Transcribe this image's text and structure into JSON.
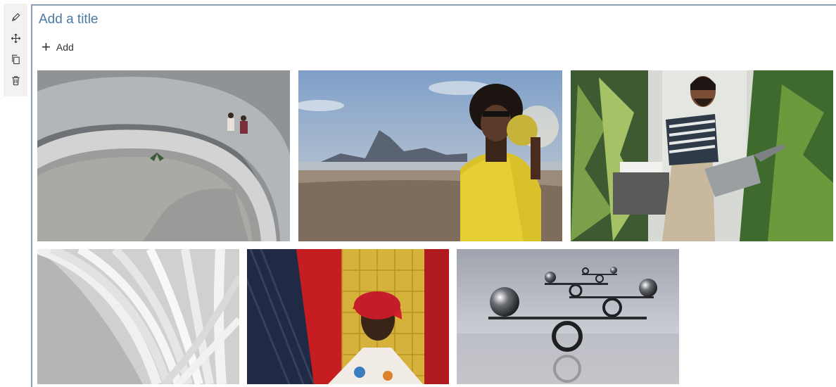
{
  "toolbar": {
    "items": [
      {
        "name": "edit",
        "icon": "pencil-icon"
      },
      {
        "name": "move",
        "icon": "move-arrows-icon"
      },
      {
        "name": "duplicate",
        "icon": "copy-icon"
      },
      {
        "name": "delete",
        "icon": "trash-icon"
      }
    ]
  },
  "webpart": {
    "title_placeholder": "Add a title",
    "add_label": "Add",
    "add_icon": "plus-icon"
  },
  "gallery": {
    "tiles": [
      {
        "id": "stairwell",
        "subject": "spiral concrete stairwell with people sitting"
      },
      {
        "id": "beach",
        "subject": "man in yellow jersey on beach holding ball"
      },
      {
        "id": "gardener",
        "subject": "man watering plants with watering can"
      },
      {
        "id": "book",
        "subject": "open book pages fanned"
      },
      {
        "id": "woman-red",
        "subject": "woman in red headwrap against yellow tile wall"
      },
      {
        "id": "balance",
        "subject": "balancing spheres on rings sculpture"
      }
    ]
  },
  "colors": {
    "title": "#4a7aa4",
    "frame_border": "#8ca0b3",
    "toolbar_bg": "#f3f2f1"
  }
}
